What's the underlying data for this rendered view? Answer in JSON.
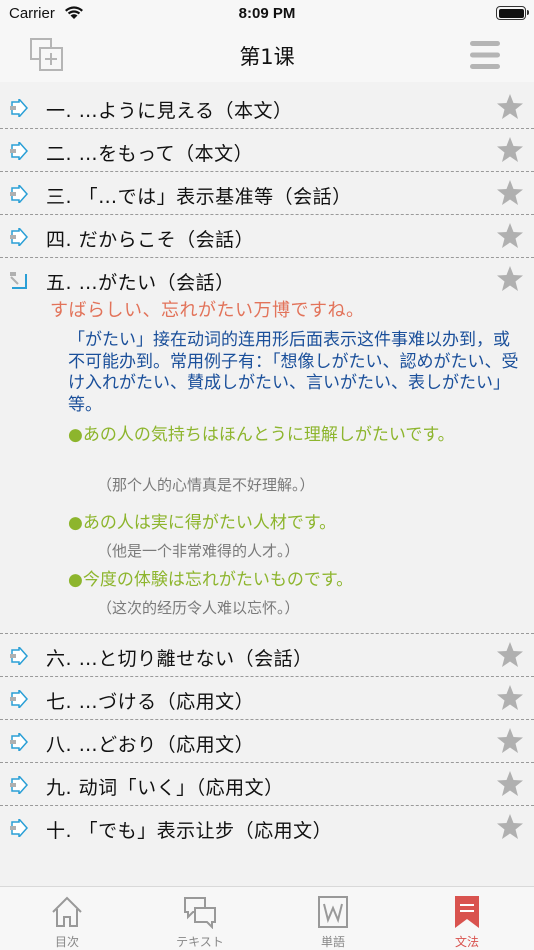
{
  "status_bar": {
    "carrier": "Carrier",
    "time": "8:09 PM",
    "battery_level": 0.95
  },
  "nav": {
    "title": "第1课",
    "left_icon": "add-note-icon",
    "right_icon": "menu-icon"
  },
  "lessons": {
    "r1": "一. …ように見える（本文）",
    "r2": "二. …をもって（本文）",
    "r3": "三. 「…では」表示基准等（会話）",
    "r4": "四. だからこそ（会話）",
    "r5": "五. …がたい（会話）",
    "r6": "六. …と切り離せない（会話）",
    "r7": "七. …づける（応用文）",
    "r8": "八. …どおり（応用文）",
    "r9": "九. 动词「いく」（応用文）",
    "r10": "十. 「でも」表示让步（応用文）"
  },
  "detail": {
    "main_example": "すばらしい、忘れがたい万博ですね。",
    "explanation": "「がたい」接在动词的连用形后面表示这件事难以办到，或不可能办到。常用例子有：「想像しがたい、認めがたい、受け入れがたい、賛成しがたい、言いがたい、表しがたい」等。",
    "ex1_jp": "●あの人の気持ちはほんとうに理解しがたいです。",
    "ex1_cn": "（那个人的心情真是不好理解。）",
    "ex2_jp": "●あの人は実に得がたい人材です。",
    "ex2_cn": "（他是一个非常难得的人才。）",
    "ex3_jp": "●今度の体験は忘れがたいものです。",
    "ex3_cn": "（这次的经历令人难以忘怀。）"
  },
  "tabs": {
    "t1": "目次",
    "t2": "テキスト",
    "t3": "単語",
    "t4": "文法",
    "active": "文法"
  },
  "colors": {
    "accent_red": "#d9534f",
    "example_orange": "#e2735a",
    "explain_blue": "#1a4f9a",
    "example_green": "#8db52d",
    "arrow_blue": "#2a9fd6",
    "star_gray": "#b0b0b0"
  }
}
